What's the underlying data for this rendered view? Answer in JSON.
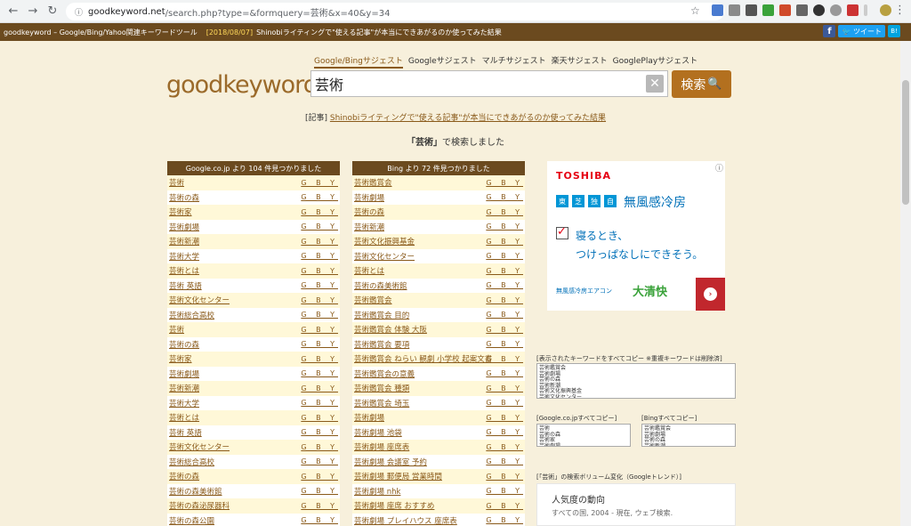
{
  "browser": {
    "url_host": "goodkeyword.net",
    "url_path": "/search.php?type=&formquery=芸術&x=40&y=34"
  },
  "topbar": {
    "site": "goodkeyword – Google/Bing/Yahoo関連キーワードツール",
    "date": "[2018/08/07]",
    "news": "Shinobiライティングで\"使える記事\"が本当にできあがるのか使ってみた結果",
    "tweet": "ツイート",
    "fb": "f",
    "hatena": "B!"
  },
  "search": {
    "tabs": [
      "Google/Bingサジェスト",
      "Googleサジェスト",
      "マルチサジェスト",
      "楽天サジェスト",
      "GooglePlayサジェスト"
    ],
    "logo": "goodkeyword",
    "query": "芸術",
    "button": "検索",
    "clear": "✕"
  },
  "article": {
    "prefix": "[記事]",
    "link": "Shinobiライティングで\"使える記事\"が本当にできあがるのか使ってみた結果"
  },
  "searched": {
    "keyword": "「芸術」",
    "suffix": "で検索しました"
  },
  "google_col": {
    "header": "Google.co.jp より 104 件見つかりました",
    "items": [
      "芸術",
      "芸術の森",
      "芸術家",
      "芸術劇場",
      "芸術新潮",
      "芸術大学",
      "芸術とは",
      "芸術 英語",
      "芸術文化センター",
      "芸術総合高校",
      "芸術",
      "芸術の森",
      "芸術家",
      "芸術劇場",
      "芸術新潮",
      "芸術大学",
      "芸術とは",
      "芸術 英語",
      "芸術文化センター",
      "芸術総合高校",
      "芸術の森",
      "芸術の森美術館",
      "芸術の森泌尿器科",
      "芸術の森公園"
    ]
  },
  "bing_col": {
    "header": "Bing より 72 件見つかりました",
    "items": [
      "芸術鑑賞会",
      "芸術劇場",
      "芸術の森",
      "芸術新潮",
      "芸術文化振興基金",
      "芸術文化センター",
      "芸術とは",
      "芸術の森美術館",
      "芸術鑑賞会",
      "芸術鑑賞会 目的",
      "芸術鑑賞会 体験 大阪",
      "芸術鑑賞会 要項",
      "芸術鑑賞会 ねらい 観劇 小学校 起案文書",
      "芸術鑑賞会の意義",
      "芸術鑑賞会 種類",
      "芸術鑑賞会 埼玉",
      "芸術劇場",
      "芸術劇場 池袋",
      "芸術劇場 座席表",
      "芸術劇場 会議室 予約",
      "芸術劇場 郵便局 営業時間",
      "芸術劇場 nhk",
      "芸術劇場 座席 おすすめ",
      "芸術劇場 プレイハウス 座席表"
    ]
  },
  "gby": "G B Y",
  "ad": {
    "brand": "TOSHIBA",
    "tags": [
      "東",
      "芝",
      "独",
      "自"
    ],
    "headline": "無風感冷房",
    "line1": "寝るとき、",
    "line2": "つけっぱなしにできそう。",
    "small": "無風感冷房エアコン",
    "bigbrand": "大清快",
    "info": "ⓘ"
  },
  "copy_all": {
    "label": "[表示されたキーワードをすべてコピー ※重複キーワードは削除済]",
    "content": "芸術鑑賞会\n芸術劇場\n芸術の森\n芸術新潮\n芸術文化振興基金\n芸術文化センター"
  },
  "copy_google": {
    "label": "[Google.co.jpすべてコピー]",
    "content": "芸術\n芸術の森\n芸術家\n芸術劇場"
  },
  "copy_bing": {
    "label": "[Bingすべてコピー]",
    "content": "芸術鑑賞会\n芸術劇場\n芸術の森\n芸術新潮"
  },
  "trend": {
    "title": "[「芸術」の検索ボリューム変化（Googleトレンド）]",
    "card_title": "人気度の動向",
    "card_sub": "すべての国, 2004 - 現在, ウェブ検索."
  },
  "colors": {
    "brown_bar": "#6b4a1f",
    "link": "#8a5a1a",
    "search_button": "#b3701f"
  }
}
